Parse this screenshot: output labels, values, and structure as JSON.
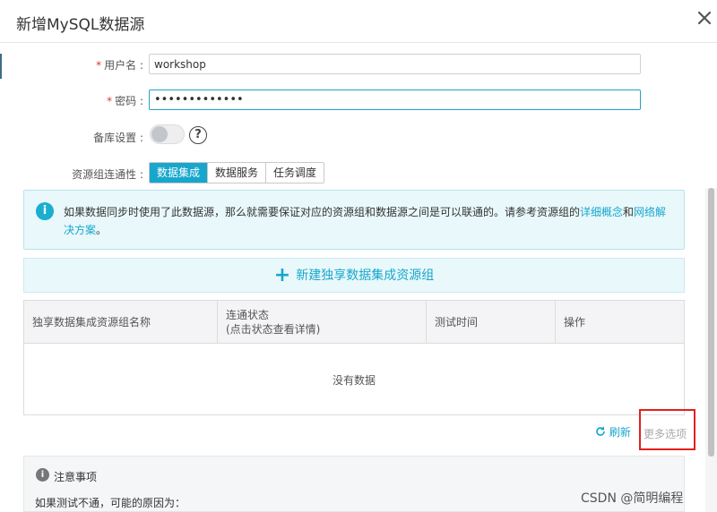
{
  "dialog": {
    "title": "新增MySQL数据源"
  },
  "form": {
    "username_label": "用户名 :",
    "username_value": "workshop",
    "password_label": "密码 :",
    "password_value": "•••••••••••••",
    "backup_label": "备库设置 :",
    "backup_enabled": false,
    "connectivity_label": "资源组连通性 :",
    "connectivity_tabs": [
      "数据集成",
      "数据服务",
      "任务调度"
    ],
    "connectivity_active": "数据集成"
  },
  "info": {
    "text": "如果数据同步时使用了此数据源，那么就需要保证对应的资源组和数据源之间是可以联通的。请参考资源组的",
    "link1": "详细概念",
    "mid": "和",
    "link2": "网络解决方案",
    "end": "。"
  },
  "create_button": {
    "label": "新建独享数据集成资源组"
  },
  "table": {
    "columns": [
      "独享数据集成资源组名称",
      "连通状态\n(点击状态查看详情)",
      "测试时间",
      "操作"
    ],
    "empty_text": "没有数据"
  },
  "actions": {
    "refresh_label": "刷新",
    "more_options_label": "更多选项"
  },
  "notes": {
    "title": "注意事项",
    "body": "如果测试不通，可能的原因为："
  },
  "watermark": "CSDN @简明编程",
  "colors": {
    "accent": "#17a7cc",
    "highlight_box": "#e02020",
    "required": "#e0362b"
  }
}
